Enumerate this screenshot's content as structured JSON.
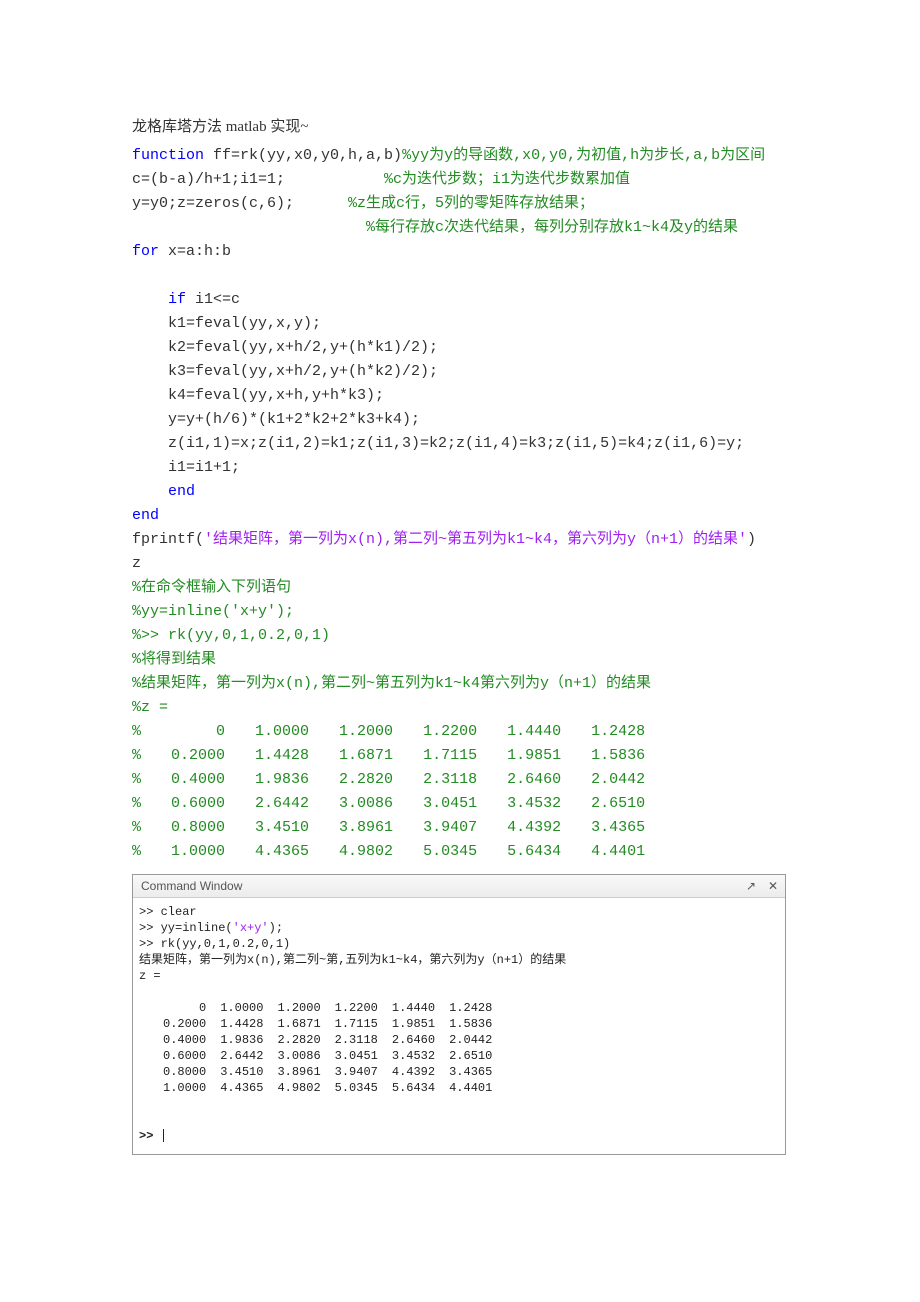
{
  "doc_title": "龙格库塔方法 matlab 实现~",
  "code": {
    "l1a": "function",
    "l1b": " ff=rk(yy,x0,y0,h,a,b)",
    "l1c": "%yy为y的导函数,x0,y0,为初值,h为步长,a,b为区间",
    "l2": "c=(b-a)/h+1;i1=1;",
    "l2c": "           %c为迭代步数；i1为迭代步数累加值",
    "l3": "y=y0;z=zeros(c,6);",
    "l3c": "      %z生成c行，5列的零矩阵存放结果；",
    "l4c": "                          %每行存放c次迭代结果，每列分别存放k1~k4及y的结果",
    "l5a": "for",
    "l5b": " x=a:h:b",
    "l6a": "    if",
    "l6b": " i1<=c",
    "l7": "    k1=feval(yy,x,y);",
    "l8": "    k2=feval(yy,x+h/2,y+(h*k1)/2);",
    "l9": "    k3=feval(yy,x+h/2,y+(h*k2)/2);",
    "l10": "    k4=feval(yy,x+h,y+h*k3);",
    "l11": "    y=y+(h/6)*(k1+2*k2+2*k3+k4);",
    "l12": "    z(i1,1)=x;z(i1,2)=k1;z(i1,3)=k2;z(i1,4)=k3;z(i1,5)=k4;z(i1,6)=y;",
    "l13": "    i1=i1+1;",
    "l14": "    end",
    "l15": "end",
    "l16a": "fprintf(",
    "l16b": "'结果矩阵，第一列为x(n),第二列~第五列为k1~k4，第六列为y（n+1）的结果'",
    "l16c": ")",
    "l17": "z",
    "l18": "%在命令框输入下列语句",
    "l19": "%yy=inline('x+y');",
    "l20": "%>> rk(yy,0,1,0.2,0,1)",
    "l21": "%将得到结果",
    "l22": "%结果矩阵，第一列为x(n),第二列~第五列为k1~k4第六列为y（n+1）的结果",
    "l23": "%z ="
  },
  "big_rows": [
    [
      "  %",
      "0",
      "1.0000",
      "1.2000",
      "1.2200",
      "1.4440",
      "1.2428"
    ],
    [
      "  %",
      "0.2000",
      "1.4428",
      "1.6871",
      "1.7115",
      "1.9851",
      "1.5836"
    ],
    [
      "  %",
      "0.4000",
      "1.9836",
      "2.2820",
      "2.3118",
      "2.6460",
      "2.0442"
    ],
    [
      "  %",
      "0.6000",
      "2.6442",
      "3.0086",
      "3.0451",
      "3.4532",
      "2.6510"
    ],
    [
      "  %",
      "0.8000",
      "3.4510",
      "3.8961",
      "3.9407",
      "4.4392",
      "3.4365"
    ],
    [
      "  %",
      "1.0000",
      "4.4365",
      "4.9802",
      "5.0345",
      "5.6434",
      "4.4401"
    ]
  ],
  "cmd": {
    "title": "Command Window",
    "lines": {
      "l1": ">> clear",
      "l2a": ">> yy=inline(",
      "l2b": "'x+y'",
      "l2c": ");",
      "l3": ">> rk(yy,0,1,0.2,0,1)",
      "l4": "结果矩阵，第一列为x(n),第二列~第,五列为k1~k4，第六列为y（n+1）的结果",
      "l5": "z =",
      "prompt": ">> "
    }
  },
  "small_rows": [
    [
      "0",
      "1.0000",
      "1.2000",
      "1.2200",
      "1.4440",
      "1.2428"
    ],
    [
      "0.2000",
      "1.4428",
      "1.6871",
      "1.7115",
      "1.9851",
      "1.5836"
    ],
    [
      "0.4000",
      "1.9836",
      "2.2820",
      "2.3118",
      "2.6460",
      "2.0442"
    ],
    [
      "0.6000",
      "2.6442",
      "3.0086",
      "3.0451",
      "3.4532",
      "2.6510"
    ],
    [
      "0.8000",
      "3.4510",
      "3.8961",
      "3.9407",
      "4.4392",
      "3.4365"
    ],
    [
      "1.0000",
      "4.4365",
      "4.9802",
      "5.0345",
      "5.6434",
      "4.4401"
    ]
  ]
}
